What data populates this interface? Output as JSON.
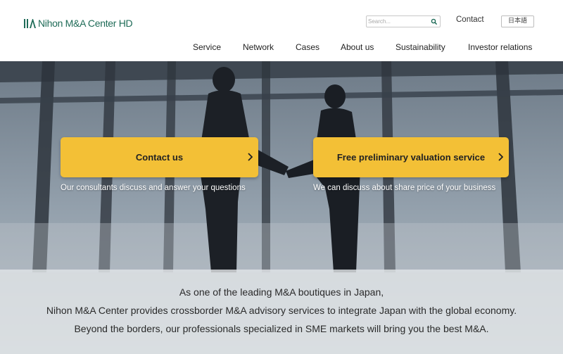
{
  "logo": {
    "text": "Nihon M&A Center HD"
  },
  "search": {
    "placeholder": "Search..."
  },
  "header": {
    "contact_label": "Contact",
    "language_label": "日本語"
  },
  "nav": {
    "items": [
      {
        "label": "Service"
      },
      {
        "label": "Network"
      },
      {
        "label": "Cases"
      },
      {
        "label": "About us"
      },
      {
        "label": "Sustainability"
      },
      {
        "label": "Investor relations"
      }
    ]
  },
  "cta": {
    "contact": {
      "label": "Contact us",
      "subtext": "Our consultants discuss and answer your questions"
    },
    "valuation": {
      "label": "Free preliminary valuation service",
      "subtext": "We can discuss about share price of your business"
    }
  },
  "tagline": {
    "line1": "As one of the leading M&A boutiques in Japan,",
    "line2": "Nihon M&A Center provides crossborder M&A advisory services to integrate Japan with the global economy.",
    "line3": "Beyond the borders, our professionals specialized in SME markets will bring you the best M&A."
  },
  "colors": {
    "brand_green": "#1e6b57",
    "cta_yellow": "#f3c036"
  },
  "icons": {
    "search": "search-icon",
    "cta_arrow": "chevron-right-icon"
  }
}
